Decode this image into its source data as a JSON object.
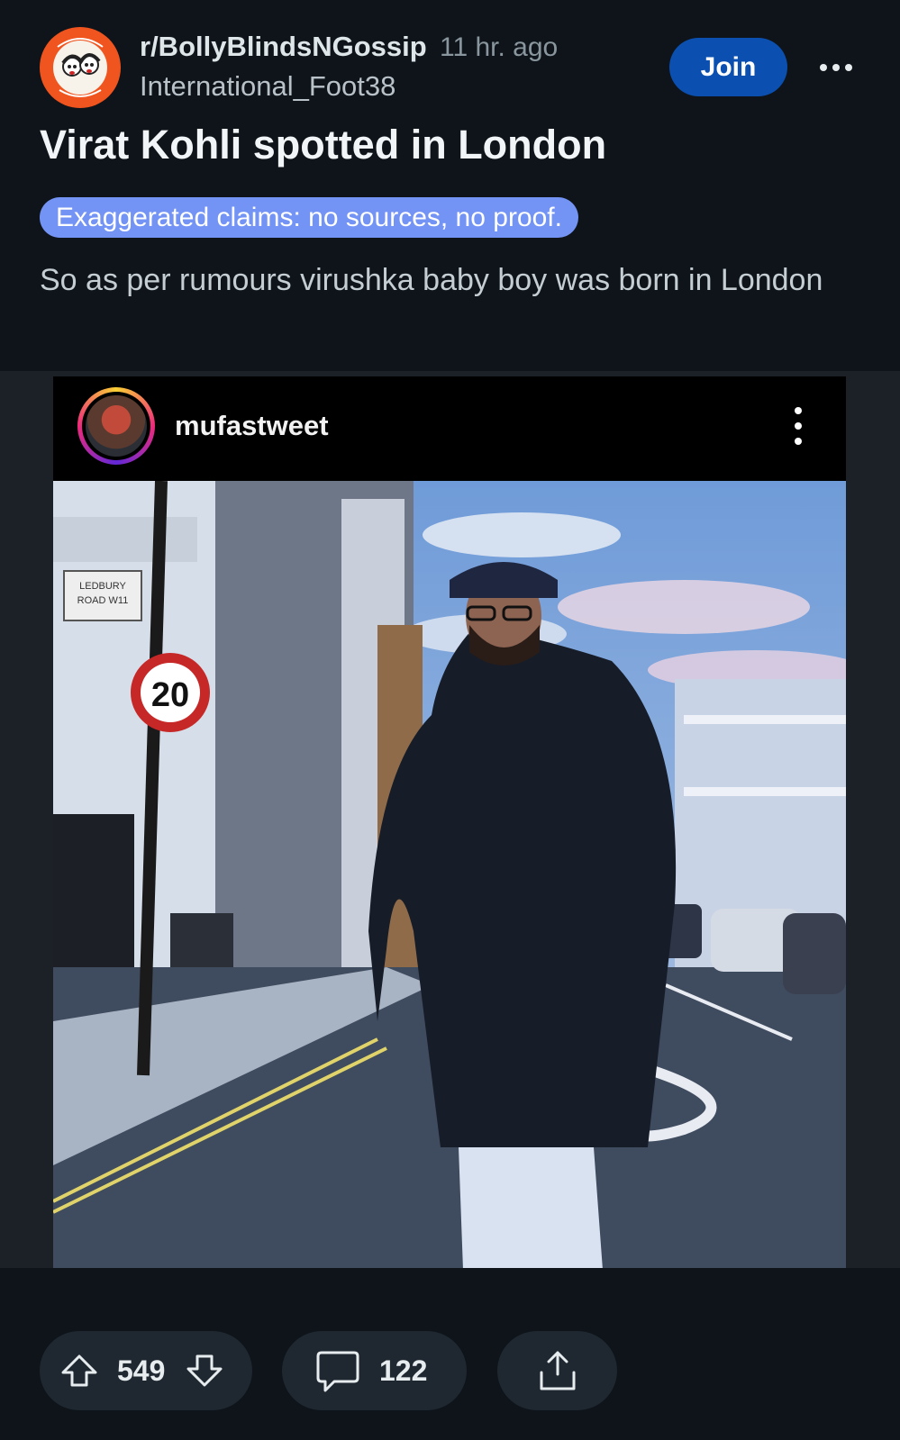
{
  "post": {
    "subreddit": "r/BollyBlindsNGossip",
    "time_ago": "11 hr. ago",
    "author": "International_Foot38",
    "join_label": "Join",
    "title": "Virat Kohli spotted in London",
    "flair": "Exaggerated claims: no sources, no proof.",
    "body": "So as per rumours virushka baby boy was born in London"
  },
  "embed": {
    "username": "mufastweet",
    "sign_street": "LEDBURY ROAD W11",
    "speed_limit": "20"
  },
  "actions": {
    "upvotes": "549",
    "comments": "122"
  },
  "colors": {
    "background": "#0e1419",
    "join_button": "#0b50b0",
    "flair": "#7393f5",
    "avatar": "#f0541f"
  }
}
